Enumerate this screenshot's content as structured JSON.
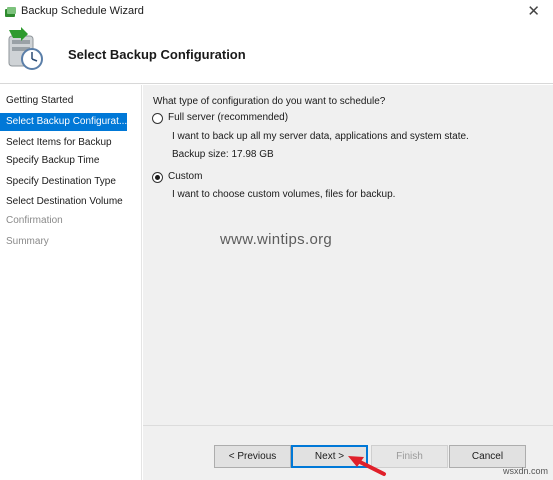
{
  "window": {
    "title": "Backup Schedule Wizard",
    "close_glyph": "✕"
  },
  "header": {
    "heading": "Select Backup Configuration",
    "icon": "backup-clock-icon"
  },
  "sidebar": {
    "items": [
      {
        "label": "Getting Started",
        "state": "normal"
      },
      {
        "label": "Select Backup Configurat...",
        "state": "selected"
      },
      {
        "label": "Select Items for Backup",
        "state": "normal"
      },
      {
        "label": "Specify Backup Time",
        "state": "normal"
      },
      {
        "label": "Specify Destination Type",
        "state": "normal"
      },
      {
        "label": "Select Destination Volume",
        "state": "normal"
      },
      {
        "label": "Confirmation",
        "state": "disabled"
      },
      {
        "label": "Summary",
        "state": "disabled"
      }
    ]
  },
  "main": {
    "question": "What type of configuration do you want to schedule?",
    "options": [
      {
        "label": "Full server (recommended)",
        "description": "I want to back up all my server data, applications and system state.",
        "extra": "Backup size: 17.98 GB",
        "selected": false
      },
      {
        "label": "Custom",
        "description": "I want to choose custom volumes, files for backup.",
        "selected": true
      }
    ]
  },
  "watermark": "www.wintips.org",
  "footer": {
    "previous_label": "< Previous",
    "next_label": "Next >",
    "finish_label": "Finish",
    "cancel_label": "Cancel"
  },
  "corner_mark": "wsxdn.com",
  "colors": {
    "accent": "#0078d7",
    "arrow": "#e0202a"
  }
}
